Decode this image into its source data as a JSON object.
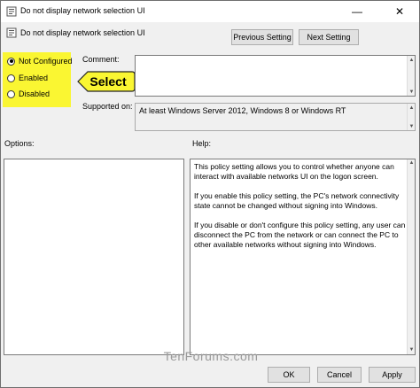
{
  "window": {
    "title": "Do not display network selection UI",
    "minimize_glyph": "—",
    "close_glyph": "✕"
  },
  "header": {
    "policy_name": "Do not display network selection UI",
    "prev_button": "Previous Setting",
    "next_button": "Next Setting"
  },
  "state": {
    "options": [
      {
        "label": "Not Configured",
        "checked": true
      },
      {
        "label": "Enabled",
        "checked": false
      },
      {
        "label": "Disabled",
        "checked": false
      }
    ],
    "callout": "Select",
    "highlight_color": "#faf632"
  },
  "comment": {
    "label": "Comment:",
    "value": ""
  },
  "supported": {
    "label": "Supported on:",
    "value": "At least Windows Server 2012, Windows 8 or Windows RT"
  },
  "options_panel": {
    "label": "Options:"
  },
  "help_panel": {
    "label": "Help:",
    "paragraphs": [
      "This policy setting allows you to control whether anyone can interact with available networks UI on the logon screen.",
      "If you enable this policy setting, the PC's network connectivity state cannot be changed without signing into Windows.",
      "If you disable or don't configure this policy setting, any user can disconnect the PC from the network or can connect the PC to other available networks without signing into Windows."
    ]
  },
  "footer": {
    "ok": "OK",
    "cancel": "Cancel",
    "apply": "Apply"
  },
  "watermark": "TenForums.com"
}
